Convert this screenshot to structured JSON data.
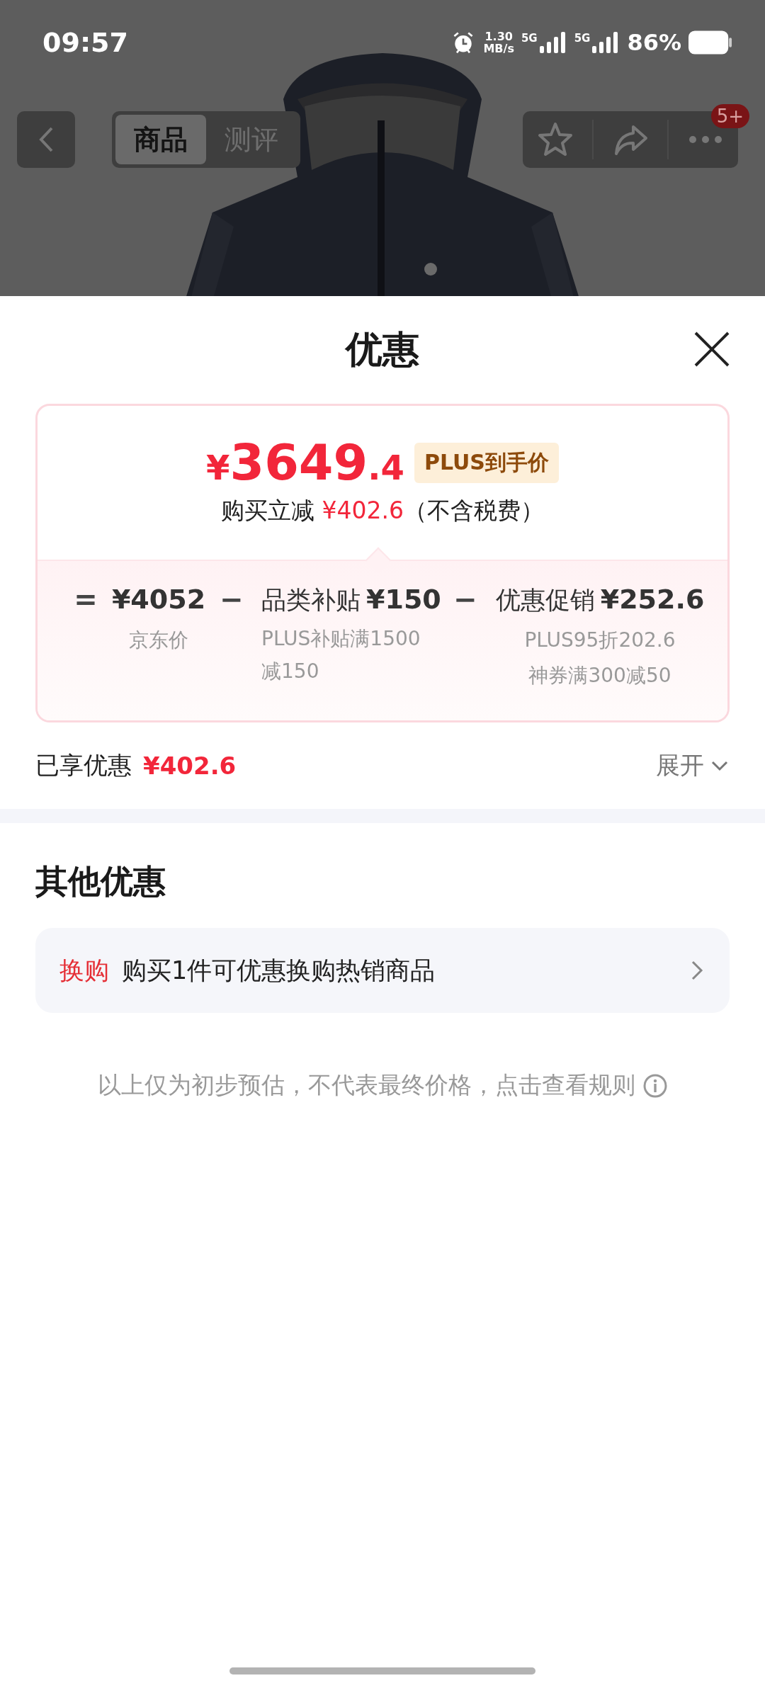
{
  "status_bar": {
    "time": "09:57",
    "speed_value": "1.30",
    "speed_unit": "MB/s",
    "sims": [
      "5G",
      "5G"
    ],
    "battery": "86%"
  },
  "nav": {
    "tabs": [
      {
        "label": "商品",
        "selected": true
      },
      {
        "label": "测评",
        "selected": false
      }
    ],
    "badge": "5+"
  },
  "sheet": {
    "title": "优惠",
    "price": {
      "currency": "¥",
      "integer": "3649",
      "decimal": ".4",
      "tag": "PLUS到手价"
    },
    "reduction": {
      "prefix": "购买立减",
      "amount": "¥402.6",
      "suffix": "（不含税费）"
    },
    "breakdown": [
      {
        "operator": "=",
        "value": "¥4052",
        "notes": [
          "京东价"
        ]
      },
      {
        "operator": "−",
        "label": "品类补贴",
        "value": "¥150",
        "notes": [
          "PLUS补贴满1500减150"
        ]
      },
      {
        "operator": "−",
        "label": "优惠促销",
        "value": "¥252.6",
        "notes": [
          "PLUS95折202.6",
          "神券满300减50"
        ]
      }
    ],
    "enjoyed": {
      "label": "已享优惠",
      "amount": "¥402.6",
      "toggle": "展开",
      "expanded": false
    },
    "other": {
      "title": "其他优惠",
      "items": [
        {
          "tag": "换购",
          "text": "购买1件可优惠换购热销商品"
        }
      ]
    },
    "footnote": "以上仅为初步预估，不代表最终价格，点击查看规则"
  }
}
